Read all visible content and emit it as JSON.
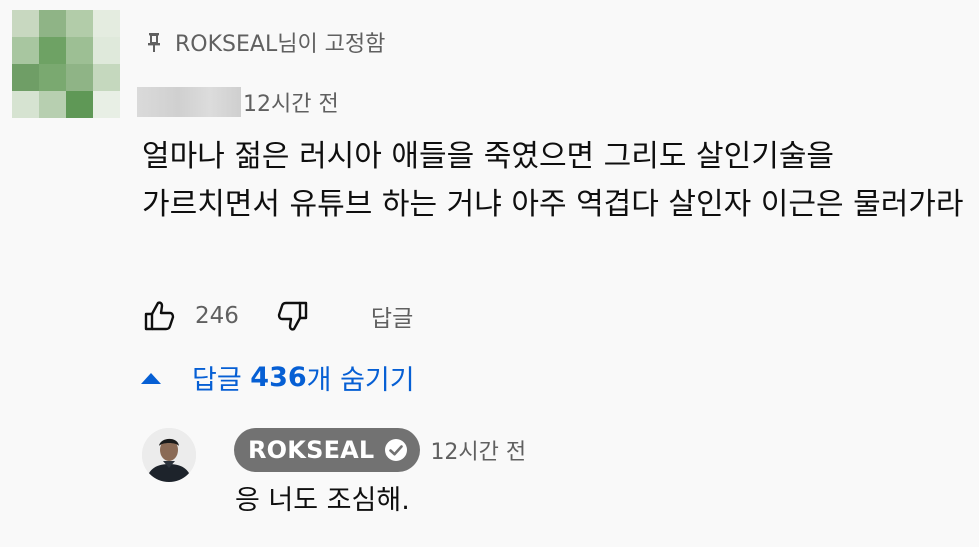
{
  "comment": {
    "pinned_label": "ROKSEAL님이 고정함",
    "time": "12시간 전",
    "text": "얼마나 젊은 러시아 애들을 죽였으면 그리도 살인기술을 가르치면서 유튜브 하는 거냐 아주 역겹다 살인자 이근은 물러가라",
    "likes": "246",
    "reply_label": "답글",
    "icons": {
      "pin": "pin-icon",
      "like": "thumbs-up-icon",
      "dislike": "thumbs-down-icon"
    },
    "avatar_palette": [
      "#c8d8c0",
      "#8fb486",
      "#b2cca9",
      "#e4ece0",
      "#a8c6a0",
      "#6ea264",
      "#9dbf94",
      "#dfe9db",
      "#6f9e66",
      "#7aa970",
      "#8fb486",
      "#c5d8be",
      "#d6e3d1",
      "#b7cfb0",
      "#5f9856",
      "#e8efe5"
    ]
  },
  "replies_toggle": {
    "prefix": "답글",
    "count": "436",
    "suffix": "개 숨기기",
    "color": "#065fd4",
    "icon": "caret-up-icon"
  },
  "reply": {
    "author": "ROKSEAL",
    "time": "12시간 전",
    "text": "응 너도 조심해.",
    "icons": {
      "verified": "verified-check-icon"
    }
  }
}
